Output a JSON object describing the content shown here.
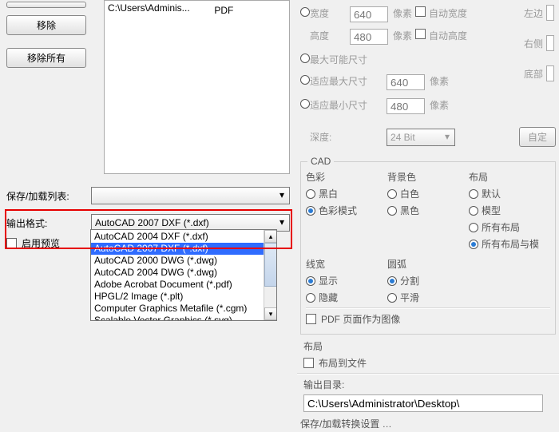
{
  "left": {
    "remove_btn": "移除",
    "remove_all_btn": "移除所有",
    "file_col1": "C:\\Users\\Adminis...",
    "file_col2": "PDF",
    "save_load_label": "保存/加载列表:",
    "output_format_label": "输出格式:",
    "enable_preview_label": "启用预览",
    "enable_preview_checked": false,
    "format_selected": "AutoCAD 2007 DXF (*.dxf)",
    "format_options": [
      "AutoCAD 2004 DXF (*.dxf)",
      "AutoCAD 2007 DXF (*.dxf)",
      "AutoCAD 2000 DWG (*.dwg)",
      "AutoCAD 2004 DWG (*.dwg)",
      "Adobe Acrobat Document (*.pdf)",
      "HPGL/2 Image (*.plt)",
      "Computer Graphics Metafile (*.cgm)",
      "Scalable Vector Graphics (*.svg)"
    ],
    "format_selected_index": 1
  },
  "right": {
    "width_label": "宽度",
    "width_val": "640",
    "height_label": "高度",
    "height_val": "480",
    "pixels": "像素",
    "auto_width": "自动宽度",
    "auto_height": "自动高度",
    "max_possible": "最大可能尺寸",
    "fit_max_label": "适应最大尺寸",
    "fit_max_val": "640",
    "fit_min_label": "适应最小尺寸",
    "fit_min_val": "480",
    "depth_label": "深度:",
    "depth_val": "24 Bit",
    "custom_btn": "自定",
    "left_label": "左边",
    "right_label": "右侧",
    "bottom_label": "底部",
    "cad_title": "CAD",
    "color": {
      "title": "色彩",
      "bw": "黑白",
      "color_mode": "色彩模式"
    },
    "bg": {
      "title": "背景色",
      "white": "白色",
      "black": "黑色"
    },
    "layout": {
      "title": "布局",
      "default": "默认",
      "model": "模型",
      "all_layouts": "所有布局",
      "all_layouts_and": "所有布局与模"
    },
    "linewidth": {
      "title": "线宽",
      "show": "显示",
      "hide": "隐藏"
    },
    "arc": {
      "title": "圆弧",
      "split": "分割",
      "smooth": "平滑"
    },
    "pdf_page_img_label": "PDF 页面作为图像",
    "layout2_title": "布局",
    "layout_to_file_label": "布局到文件",
    "output_dir_label": "输出目录:",
    "output_dir_val": "C:\\Users\\Administrator\\Desktop\\",
    "save_conv_settings": "保存/加载转换设置 …"
  }
}
